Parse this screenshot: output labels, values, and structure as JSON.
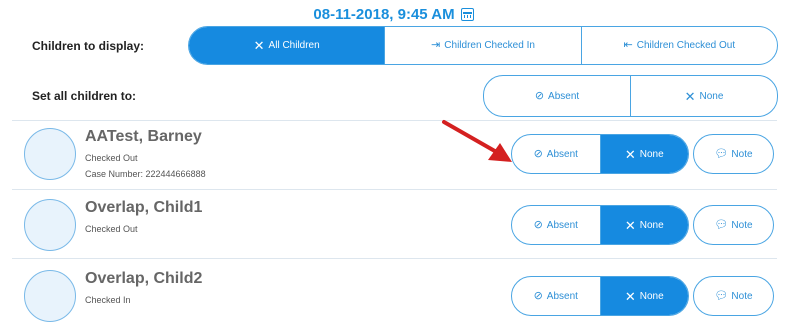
{
  "header": {
    "datetime": "08-11-2018, 9:45 AM",
    "calendar_icon": "calendar-icon"
  },
  "display_filter": {
    "label": "Children to display:",
    "options": [
      {
        "label": "All Children",
        "icon": "x-icon",
        "selected": true
      },
      {
        "label": "Children Checked In",
        "icon": "check-in-icon",
        "selected": false
      },
      {
        "label": "Children Checked Out",
        "icon": "check-out-icon",
        "selected": false
      }
    ]
  },
  "set_all": {
    "label": "Set all children to:",
    "options": [
      {
        "label": "Absent",
        "icon": "absent-icon",
        "selected": false
      },
      {
        "label": "None",
        "icon": "x-icon",
        "selected": false
      }
    ]
  },
  "children": [
    {
      "name": "AATest, Barney",
      "status": "Checked Out",
      "case_number": "Case Number: 222444666888",
      "attendance": {
        "absent_label": "Absent",
        "none_label": "None",
        "selected": "None"
      },
      "note_label": "Note"
    },
    {
      "name": "Overlap, Child1",
      "status": "Checked Out",
      "attendance": {
        "absent_label": "Absent",
        "none_label": "None",
        "selected": "None"
      },
      "note_label": "Note"
    },
    {
      "name": "Overlap, Child2",
      "status": "Checked In",
      "attendance": {
        "absent_label": "Absent",
        "none_label": "None",
        "selected": "None"
      },
      "note_label": "Note"
    }
  ],
  "colors": {
    "accent": "#168ae0",
    "border": "#4aa5e3",
    "arrow": "#d42020"
  }
}
